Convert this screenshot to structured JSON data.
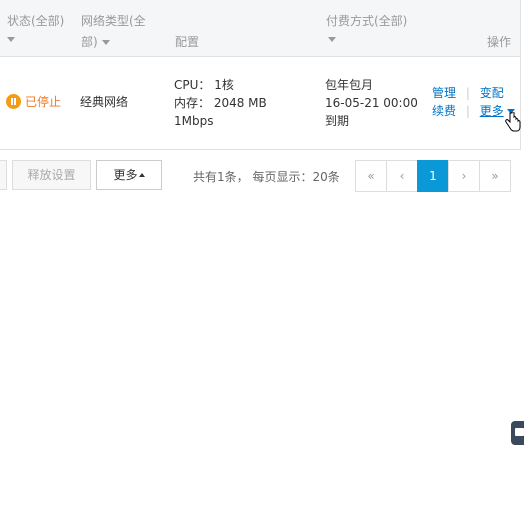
{
  "table": {
    "headers": {
      "status": "状态(全部)",
      "network_line1": "网络类型(全",
      "network_line2": "部)",
      "config": "配置",
      "payment": "付费方式(全部)",
      "actions": "操作"
    },
    "row": {
      "status": "已停止",
      "network": "经典网络",
      "config": [
        "CPU： 1核",
        "内存： 2048 MB",
        "1Mbps"
      ],
      "payment": [
        "包年包月",
        "16-05-21 00:00",
        "到期"
      ],
      "actions": {
        "manage": "管理",
        "change_config": "变配",
        "renew": "续费",
        "more": "更多"
      }
    }
  },
  "footer": {
    "release_button": "释放设置",
    "more_button": "更多",
    "summary": "共有1条， 每页显示：20条",
    "pagination": {
      "first": "«",
      "prev": "‹",
      "current": "1",
      "next": "›",
      "last": "»"
    }
  },
  "colors": {
    "status_stopped": "#ee7a23",
    "link": "#0073c6",
    "active_page": "#0a98d6"
  }
}
